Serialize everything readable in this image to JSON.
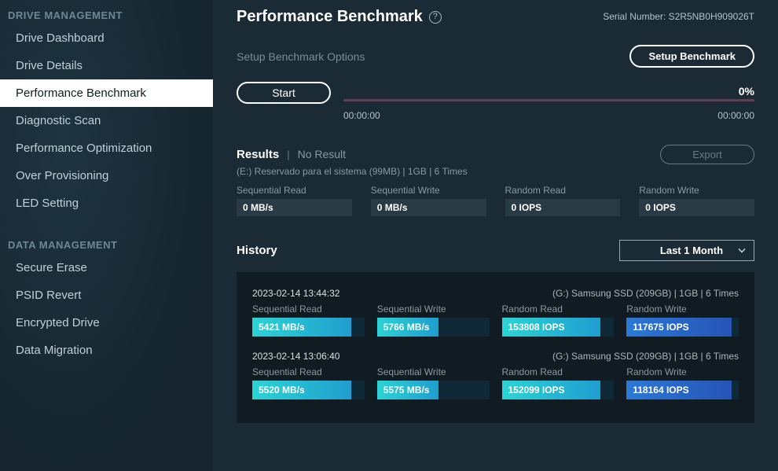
{
  "sidebar": {
    "groups": [
      {
        "title": "DRIVE MANAGEMENT",
        "items": [
          {
            "label": "Drive Dashboard",
            "active": false
          },
          {
            "label": "Drive Details",
            "active": false
          },
          {
            "label": "Performance Benchmark",
            "active": true
          },
          {
            "label": "Diagnostic Scan",
            "active": false
          },
          {
            "label": "Performance Optimization",
            "active": false
          },
          {
            "label": "Over Provisioning",
            "active": false
          },
          {
            "label": "LED Setting",
            "active": false
          }
        ]
      },
      {
        "title": "DATA MANAGEMENT",
        "items": [
          {
            "label": "Secure Erase",
            "active": false
          },
          {
            "label": "PSID Revert",
            "active": false
          },
          {
            "label": "Encrypted Drive",
            "active": false
          },
          {
            "label": "Data Migration",
            "active": false
          }
        ]
      }
    ]
  },
  "header": {
    "title": "Performance Benchmark",
    "serial_prefix": "Serial Number: ",
    "serial": "S2R5NB0H909026T"
  },
  "setup": {
    "label": "Setup Benchmark Options",
    "button": "Setup Benchmark"
  },
  "run": {
    "start": "Start",
    "percent": "0%",
    "elapsed": "00:00:00",
    "remaining": "00:00:00"
  },
  "results": {
    "title": "Results",
    "status": "No Result",
    "subline": "(E:) Reservado para el sistema (99MB)   |   1GB   |   6 Times",
    "export_label": "Export",
    "metrics": [
      {
        "label": "Sequential Read",
        "value": "0 MB/s"
      },
      {
        "label": "Sequential Write",
        "value": "0 MB/s"
      },
      {
        "label": "Random Read",
        "value": "0 IOPS"
      },
      {
        "label": "Random Write",
        "value": "0 IOPS"
      }
    ]
  },
  "history": {
    "title": "History",
    "filter": "Last 1 Month",
    "entries": [
      {
        "timestamp": "2023-02-14 13:44:32",
        "details": "(G:) Samsung SSD (209GB)   |   1GB   |   6 Times",
        "metrics": [
          {
            "label": "Sequential Read",
            "value": "5421 MB/s",
            "fill": 88,
            "style": "cyan"
          },
          {
            "label": "Sequential Write",
            "value": "5766 MB/s",
            "fill": 55,
            "style": "cyan"
          },
          {
            "label": "Random Read",
            "value": "153808 IOPS",
            "fill": 88,
            "style": "cyan"
          },
          {
            "label": "Random Write",
            "value": "117675 IOPS",
            "fill": 94,
            "style": "blue"
          }
        ]
      },
      {
        "timestamp": "2023-02-14 13:06:40",
        "details": "(G:) Samsung SSD (209GB)   |   1GB   |   6 Times",
        "metrics": [
          {
            "label": "Sequential Read",
            "value": "5520 MB/s",
            "fill": 88,
            "style": "cyan"
          },
          {
            "label": "Sequential Write",
            "value": "5575 MB/s",
            "fill": 55,
            "style": "cyan"
          },
          {
            "label": "Random Read",
            "value": "152099 IOPS",
            "fill": 88,
            "style": "cyan"
          },
          {
            "label": "Random Write",
            "value": "118164 IOPS",
            "fill": 94,
            "style": "blue"
          }
        ]
      }
    ]
  }
}
